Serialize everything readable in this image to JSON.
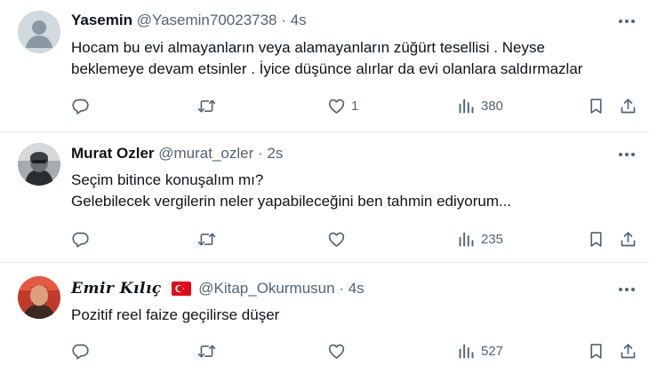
{
  "tweets": [
    {
      "display_name": "Yasemin",
      "handle": "@Yasemin70023738",
      "separator": "·",
      "time": "4s",
      "lines": [
        "Hocam bu evi almayanların veya alamayanların züğürt tesellisi . Neyse",
        "beklemeye devam etsinler . İyice düşünce alırlar da evi olanlara saldırmazlar"
      ],
      "likes": "1",
      "views": "380"
    },
    {
      "display_name": "Murat Ozler",
      "handle": "@murat_ozler",
      "separator": "·",
      "time": "2s",
      "lines": [
        "Seçim bitince konuşalım mı?",
        "Gelebilecek vergilerin neler yapabileceğini ben tahmin ediyorum..."
      ],
      "likes": "",
      "views": "235"
    },
    {
      "display_name": "Emir Kılıç",
      "handle": "@Kitap_Okurmusun",
      "separator": "·",
      "time": "4s",
      "lines": [
        "Pozitif reel faize geçilirse düşer"
      ],
      "likes": "",
      "views": "527"
    }
  ],
  "icons": {
    "more": "more-horizontal-icon",
    "reply": "reply-icon",
    "retweet": "retweet-icon",
    "like": "heart-icon",
    "views": "views-icon",
    "bookmark": "bookmark-icon",
    "share": "share-icon",
    "flag": "turkey-flag-icon"
  },
  "colors": {
    "text": "#0f1419",
    "secondary": "#536471",
    "divider": "#e6e9ec",
    "flag_red": "#e30a17"
  }
}
